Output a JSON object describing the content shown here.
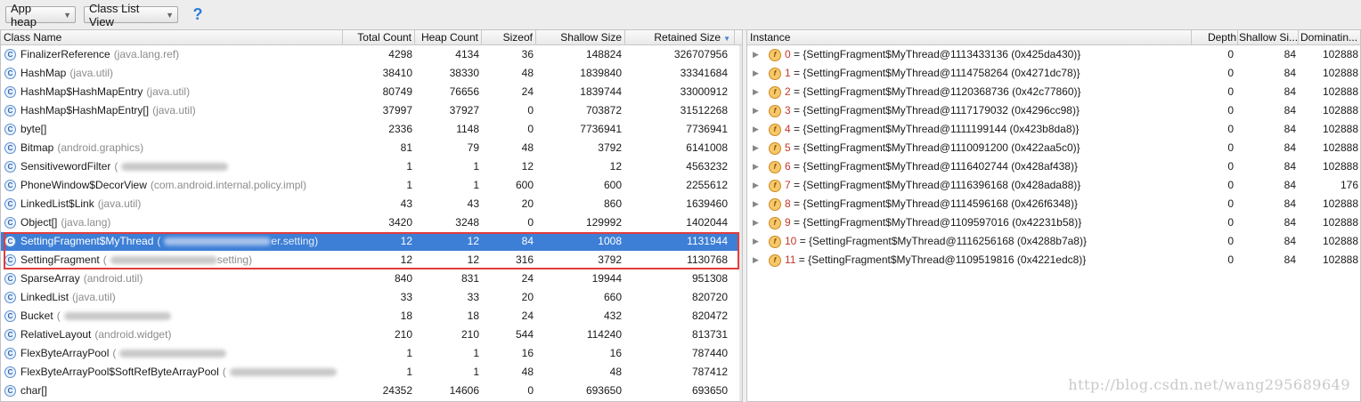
{
  "toolbar": {
    "heap_select": "App heap",
    "view_select": "Class List View",
    "help_glyph": "?"
  },
  "left_table": {
    "columns": [
      "Class Name",
      "Total Count",
      "Heap Count",
      "Sizeof",
      "Shallow Size",
      "Retained Size"
    ],
    "sort_indicator": "▼",
    "rows": [
      {
        "name": "FinalizerReference",
        "pkg": "(java.lang.ref)",
        "total": "4298",
        "heap": "4134",
        "sizeof": "36",
        "shallow": "148824",
        "retained": "326707956"
      },
      {
        "name": "HashMap",
        "pkg": "(java.util)",
        "total": "38410",
        "heap": "38330",
        "sizeof": "48",
        "shallow": "1839840",
        "retained": "33341684"
      },
      {
        "name": "HashMap$HashMapEntry",
        "pkg": "(java.util)",
        "total": "80749",
        "heap": "76656",
        "sizeof": "24",
        "shallow": "1839744",
        "retained": "33000912"
      },
      {
        "name": "HashMap$HashMapEntry[]",
        "pkg": "(java.util)",
        "total": "37997",
        "heap": "37927",
        "sizeof": "0",
        "shallow": "703872",
        "retained": "31512268"
      },
      {
        "name": "byte[]",
        "pkg": "",
        "total": "2336",
        "heap": "1148",
        "sizeof": "0",
        "shallow": "7736941",
        "retained": "7736941"
      },
      {
        "name": "Bitmap",
        "pkg": "(android.graphics)",
        "total": "81",
        "heap": "79",
        "sizeof": "48",
        "shallow": "3792",
        "retained": "6141008"
      },
      {
        "name": "SensitivewordFilter",
        "pkg": "(",
        "blur": true,
        "total": "1",
        "heap": "1",
        "sizeof": "12",
        "shallow": "12",
        "retained": "4563232"
      },
      {
        "name": "PhoneWindow$DecorView",
        "pkg": "(com.android.internal.policy.impl)",
        "total": "1",
        "heap": "1",
        "sizeof": "600",
        "shallow": "600",
        "retained": "2255612"
      },
      {
        "name": "LinkedList$Link",
        "pkg": "(java.util)",
        "total": "43",
        "heap": "43",
        "sizeof": "20",
        "shallow": "860",
        "retained": "1639460"
      },
      {
        "name": "Object[]",
        "pkg": "(java.lang)",
        "total": "3420",
        "heap": "3248",
        "sizeof": "0",
        "shallow": "129992",
        "retained": "1402044"
      },
      {
        "name": "SettingFragment$MyThread",
        "pkg": "(",
        "blur": true,
        "suffix": "er.setting)",
        "total": "12",
        "heap": "12",
        "sizeof": "84",
        "shallow": "1008",
        "retained": "1131944",
        "selected": true
      },
      {
        "name": "SettingFragment",
        "pkg": "(",
        "blur": true,
        "suffix": "setting)",
        "total": "12",
        "heap": "12",
        "sizeof": "316",
        "shallow": "3792",
        "retained": "1130768"
      },
      {
        "name": "SparseArray",
        "pkg": "(android.util)",
        "total": "840",
        "heap": "831",
        "sizeof": "24",
        "shallow": "19944",
        "retained": "951308"
      },
      {
        "name": "LinkedList",
        "pkg": "(java.util)",
        "total": "33",
        "heap": "33",
        "sizeof": "20",
        "shallow": "660",
        "retained": "820720"
      },
      {
        "name": "Bucket",
        "pkg": "(",
        "blur": true,
        "total": "18",
        "heap": "18",
        "sizeof": "24",
        "shallow": "432",
        "retained": "820472"
      },
      {
        "name": "RelativeLayout",
        "pkg": "(android.widget)",
        "total": "210",
        "heap": "210",
        "sizeof": "544",
        "shallow": "114240",
        "retained": "813731"
      },
      {
        "name": "FlexByteArrayPool",
        "pkg": "(",
        "blur": true,
        "total": "1",
        "heap": "1",
        "sizeof": "16",
        "shallow": "16",
        "retained": "787440"
      },
      {
        "name": "FlexByteArrayPool$SoftRefByteArrayPool",
        "pkg": "(",
        "blur": true,
        "total": "1",
        "heap": "1",
        "sizeof": "48",
        "shallow": "48",
        "retained": "787412"
      },
      {
        "name": "char[]",
        "pkg": "",
        "total": "24352",
        "heap": "14606",
        "sizeof": "0",
        "shallow": "693650",
        "retained": "693650"
      }
    ]
  },
  "right_table": {
    "columns": [
      "Instance",
      "Depth",
      "Shallow Si...",
      "Dominatin..."
    ],
    "rows": [
      {
        "idx": "0",
        "text": " = {SettingFragment$MyThread@1113433136 (0x425da430)}",
        "depth": "0",
        "shallow": "84",
        "dominating": "102888"
      },
      {
        "idx": "1",
        "text": " = {SettingFragment$MyThread@1114758264 (0x4271dc78)}",
        "depth": "0",
        "shallow": "84",
        "dominating": "102888"
      },
      {
        "idx": "2",
        "text": " = {SettingFragment$MyThread@1120368736 (0x42c77860)}",
        "depth": "0",
        "shallow": "84",
        "dominating": "102888"
      },
      {
        "idx": "3",
        "text": " = {SettingFragment$MyThread@1117179032 (0x4296cc98)}",
        "depth": "0",
        "shallow": "84",
        "dominating": "102888"
      },
      {
        "idx": "4",
        "text": " = {SettingFragment$MyThread@1111199144 (0x423b8da8)}",
        "depth": "0",
        "shallow": "84",
        "dominating": "102888"
      },
      {
        "idx": "5",
        "text": " = {SettingFragment$MyThread@1110091200 (0x422aa5c0)}",
        "depth": "0",
        "shallow": "84",
        "dominating": "102888"
      },
      {
        "idx": "6",
        "text": " = {SettingFragment$MyThread@1116402744 (0x428af438)}",
        "depth": "0",
        "shallow": "84",
        "dominating": "102888"
      },
      {
        "idx": "7",
        "text": " = {SettingFragment$MyThread@1116396168 (0x428ada88)}",
        "depth": "0",
        "shallow": "84",
        "dominating": "176"
      },
      {
        "idx": "8",
        "text": " = {SettingFragment$MyThread@1114596168 (0x426f6348)}",
        "depth": "0",
        "shallow": "84",
        "dominating": "102888"
      },
      {
        "idx": "9",
        "text": " = {SettingFragment$MyThread@1109597016 (0x42231b58)}",
        "depth": "0",
        "shallow": "84",
        "dominating": "102888"
      },
      {
        "idx": "10",
        "text": " = {SettingFragment$MyThread@1116256168 (0x4288b7a8)}",
        "depth": "0",
        "shallow": "84",
        "dominating": "102888"
      },
      {
        "idx": "11",
        "text": " = {SettingFragment$MyThread@1109519816 (0x4221edc8)}",
        "depth": "0",
        "shallow": "84",
        "dominating": "102888"
      }
    ]
  },
  "watermark": "http://blog.csdn.net/wang295689649",
  "colors": {
    "selection": "#3d7fd6",
    "highlight_box": "#e23c3c"
  }
}
